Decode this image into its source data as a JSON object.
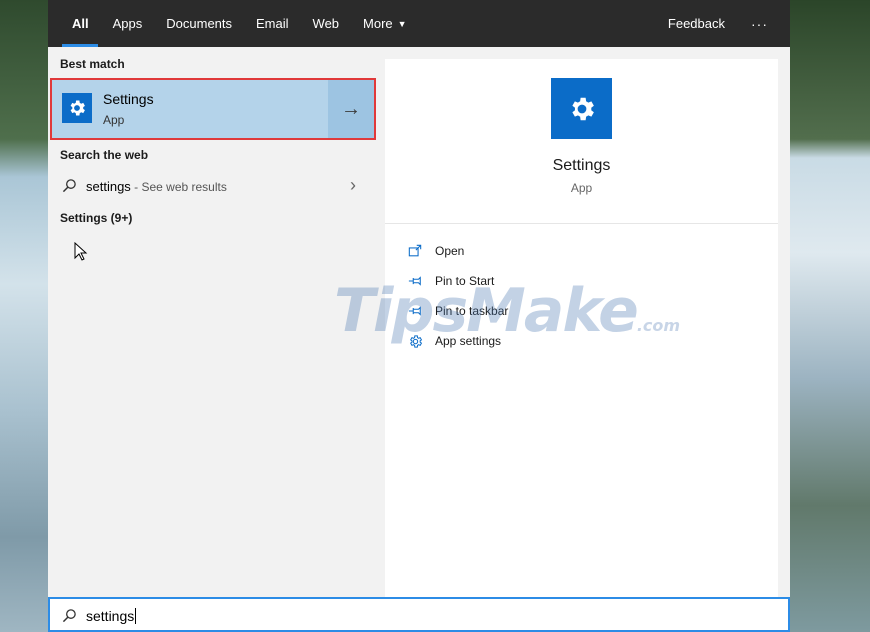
{
  "tabs": [
    {
      "label": "All"
    },
    {
      "label": "Apps"
    },
    {
      "label": "Documents"
    },
    {
      "label": "Email"
    },
    {
      "label": "Web"
    },
    {
      "label": "More"
    }
  ],
  "topbar": {
    "feedback": "Feedback",
    "more_options": "···"
  },
  "left": {
    "best_match_heading": "Best match",
    "best_match": {
      "name": "Settings",
      "type": "App",
      "icon": "gear-icon"
    },
    "search_web_heading": "Search the web",
    "web_result": {
      "query": "settings",
      "suffix": " - See web results"
    },
    "settings_group": "Settings (9+)"
  },
  "preview": {
    "name": "Settings",
    "type": "App",
    "actions": [
      {
        "label": "Open",
        "icon": "open-window-icon"
      },
      {
        "label": "Pin to Start",
        "icon": "pin-icon"
      },
      {
        "label": "Pin to taskbar",
        "icon": "pin-icon"
      },
      {
        "label": "App settings",
        "icon": "gear-icon"
      }
    ]
  },
  "watermark": {
    "brand": "TipsMake",
    "suffix": ".com"
  },
  "search": {
    "value": "settings"
  },
  "colors": {
    "accent": "#0b6cc8",
    "selection": "#b4d3ea",
    "highlight_border": "#e0393a",
    "topbar": "#2b2b2b"
  }
}
